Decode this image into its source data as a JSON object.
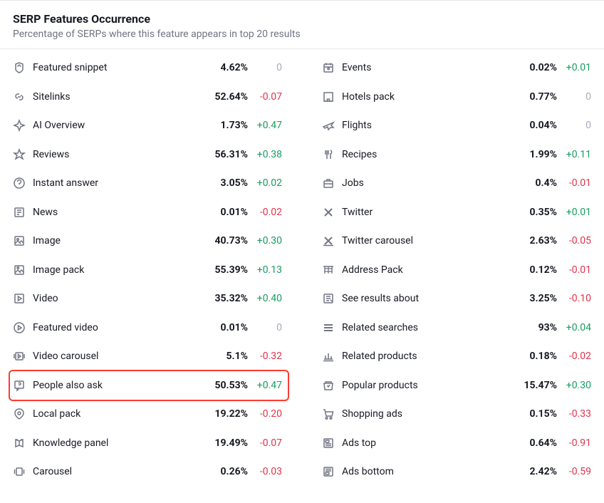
{
  "header": {
    "title": "SERP Features Occurrence",
    "subtitle": "Percentage of SERPs where this feature appears in top 20 results"
  },
  "columns": [
    [
      {
        "icon": "featured-snippet-icon",
        "label": "Featured snippet",
        "pct": "4.62%",
        "delta": "0",
        "dclass": "zero"
      },
      {
        "icon": "sitelinks-icon",
        "label": "Sitelinks",
        "pct": "52.64%",
        "delta": "-0.07",
        "dclass": "neg"
      },
      {
        "icon": "ai-overview-icon",
        "label": "AI Overview",
        "pct": "1.73%",
        "delta": "+0.47",
        "dclass": "pos"
      },
      {
        "icon": "reviews-icon",
        "label": "Reviews",
        "pct": "56.31%",
        "delta": "+0.38",
        "dclass": "pos"
      },
      {
        "icon": "instant-answer-icon",
        "label": "Instant answer",
        "pct": "3.05%",
        "delta": "+0.02",
        "dclass": "pos"
      },
      {
        "icon": "news-icon",
        "label": "News",
        "pct": "0.01%",
        "delta": "-0.02",
        "dclass": "neg"
      },
      {
        "icon": "image-icon",
        "label": "Image",
        "pct": "40.73%",
        "delta": "+0.30",
        "dclass": "pos"
      },
      {
        "icon": "image-pack-icon",
        "label": "Image pack",
        "pct": "55.39%",
        "delta": "+0.13",
        "dclass": "pos"
      },
      {
        "icon": "video-icon",
        "label": "Video",
        "pct": "35.32%",
        "delta": "+0.40",
        "dclass": "pos"
      },
      {
        "icon": "featured-video-icon",
        "label": "Featured video",
        "pct": "0.01%",
        "delta": "0",
        "dclass": "zero"
      },
      {
        "icon": "video-carousel-icon",
        "label": "Video carousel",
        "pct": "5.1%",
        "delta": "-0.32",
        "dclass": "neg"
      },
      {
        "icon": "people-also-ask-icon",
        "label": "People also ask",
        "pct": "50.53%",
        "delta": "+0.47",
        "dclass": "pos",
        "highlight": true
      },
      {
        "icon": "local-pack-icon",
        "label": "Local pack",
        "pct": "19.22%",
        "delta": "-0.20",
        "dclass": "neg"
      },
      {
        "icon": "knowledge-panel-icon",
        "label": "Knowledge panel",
        "pct": "19.49%",
        "delta": "-0.07",
        "dclass": "neg"
      },
      {
        "icon": "carousel-icon",
        "label": "Carousel",
        "pct": "0.26%",
        "delta": "-0.03",
        "dclass": "neg"
      }
    ],
    [
      {
        "icon": "events-icon",
        "label": "Events",
        "pct": "0.02%",
        "delta": "+0.01",
        "dclass": "pos"
      },
      {
        "icon": "hotels-pack-icon",
        "label": "Hotels pack",
        "pct": "0.77%",
        "delta": "0",
        "dclass": "zero"
      },
      {
        "icon": "flights-icon",
        "label": "Flights",
        "pct": "0.04%",
        "delta": "0",
        "dclass": "zero"
      },
      {
        "icon": "recipes-icon",
        "label": "Recipes",
        "pct": "1.99%",
        "delta": "+0.11",
        "dclass": "pos"
      },
      {
        "icon": "jobs-icon",
        "label": "Jobs",
        "pct": "0.4%",
        "delta": "-0.01",
        "dclass": "neg"
      },
      {
        "icon": "twitter-icon",
        "label": "Twitter",
        "pct": "0.35%",
        "delta": "+0.01",
        "dclass": "pos"
      },
      {
        "icon": "twitter-carousel-icon",
        "label": "Twitter carousel",
        "pct": "2.63%",
        "delta": "-0.05",
        "dclass": "neg"
      },
      {
        "icon": "address-pack-icon",
        "label": "Address Pack",
        "pct": "0.12%",
        "delta": "-0.01",
        "dclass": "neg"
      },
      {
        "icon": "see-results-about-icon",
        "label": "See results about",
        "pct": "3.25%",
        "delta": "-0.10",
        "dclass": "neg"
      },
      {
        "icon": "related-searches-icon",
        "label": "Related searches",
        "pct": "93%",
        "delta": "+0.04",
        "dclass": "pos"
      },
      {
        "icon": "related-products-icon",
        "label": "Related products",
        "pct": "0.18%",
        "delta": "-0.02",
        "dclass": "neg"
      },
      {
        "icon": "popular-products-icon",
        "label": "Popular products",
        "pct": "15.47%",
        "delta": "+0.30",
        "dclass": "pos"
      },
      {
        "icon": "shopping-ads-icon",
        "label": "Shopping ads",
        "pct": "0.15%",
        "delta": "-0.33",
        "dclass": "neg"
      },
      {
        "icon": "ads-top-icon",
        "label": "Ads top",
        "pct": "0.64%",
        "delta": "-0.91",
        "dclass": "neg"
      },
      {
        "icon": "ads-bottom-icon",
        "label": "Ads bottom",
        "pct": "2.42%",
        "delta": "-0.59",
        "dclass": "neg"
      }
    ]
  ]
}
